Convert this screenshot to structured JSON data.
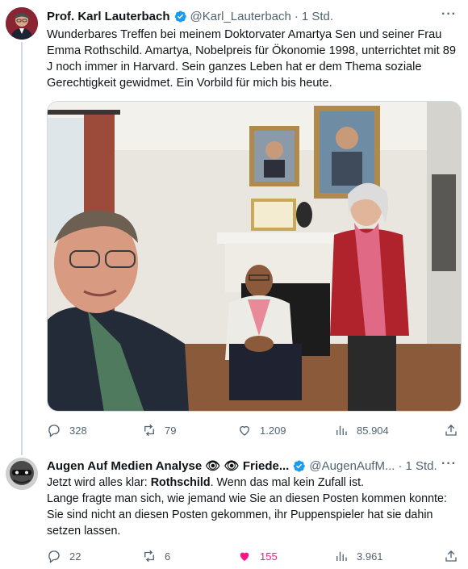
{
  "tweet1": {
    "author_name": "Prof. Karl Lauterbach",
    "handle": "@Karl_Lauterbach",
    "separator": "·",
    "time": "1 Std.",
    "text": "Wunderbares Treffen bei meinem Doktorvater Amartya Sen und seiner Frau Emma Rothschild. Amartya, Nobelpreis für Ökonomie 1998, unterrichtet mit 89 J noch immer in Harvard. Sein ganzes Leben hat er dem Thema soziale Gerechtigkeit gewidmet. Ein Vorbild für mich bis heute.",
    "replies": "328",
    "retweets": "79",
    "likes": "1.209",
    "views": "85.904",
    "more_icon": "more-icon"
  },
  "tweet2": {
    "author_name": "Augen Auf Medien Analyse 👁 👁 Friede...",
    "handle": "@AugenAufM...",
    "separator": "·",
    "time": "1 Std.",
    "text_part1": "Jetzt wird alles klar: ",
    "text_bold": "Rothschild",
    "text_part2": ". Wenn das mal kein Zufall ist.",
    "text_line2": "Lange fragte man sich, wie jemand wie Sie an diesen Posten kommen konnte: Sie sind nicht an diesen Posten gekommen, ihr Puppenspieler hat sie dahin setzen lassen.",
    "replies": "22",
    "retweets": "6",
    "likes": "155",
    "views": "3.961"
  },
  "colors": {
    "verified": "#1d9bf0",
    "liked": "#f91880",
    "secondary": "#536471"
  }
}
